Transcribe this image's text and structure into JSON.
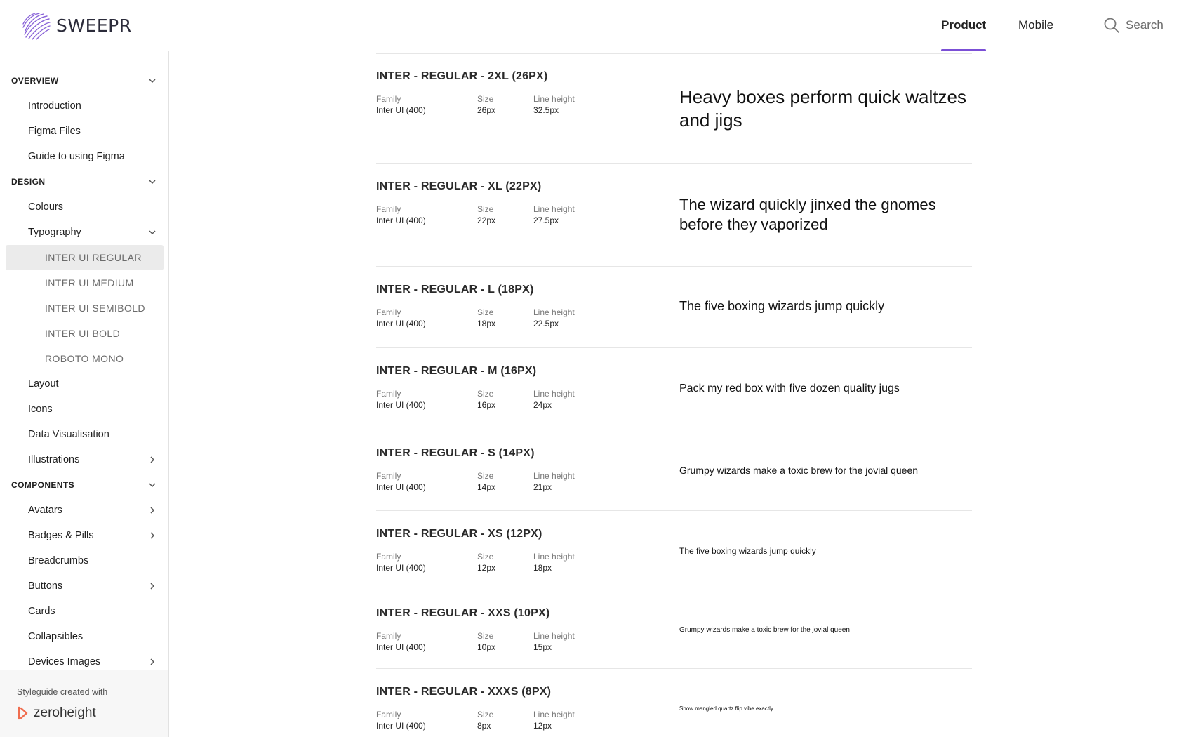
{
  "header": {
    "brand": "SWEEPR",
    "nav": [
      {
        "label": "Product",
        "active": true
      },
      {
        "label": "Mobile",
        "active": false
      }
    ],
    "search_label": "Search",
    "accent_color": "#7b4fd6"
  },
  "sidebar": {
    "overview": {
      "title": "OVERVIEW",
      "items": [
        "Introduction",
        "Figma Files",
        "Guide to using Figma"
      ]
    },
    "design": {
      "title": "DESIGN",
      "items": [
        "Colours",
        "Typography"
      ],
      "typography_sub": [
        "INTER UI REGULAR",
        "INTER UI MEDIUM",
        "INTER UI SEMIBOLD",
        "INTER UI BOLD",
        "ROBOTO MONO"
      ],
      "items_after": [
        "Layout",
        "Icons",
        "Data Visualisation",
        "Illustrations"
      ]
    },
    "components": {
      "title": "COMPONENTS",
      "items": [
        "Avatars",
        "Badges & Pills",
        "Breadcrumbs",
        "Buttons",
        "Cards",
        "Collapsibles",
        "Devices Images"
      ]
    },
    "footer": {
      "credit": "Styleguide created with",
      "brand": "zeroheight"
    }
  },
  "labels": {
    "family": "Family",
    "size": "Size",
    "line_height": "Line height"
  },
  "styles": [
    {
      "title": "INTER - REGULAR - 2XL (26PX)",
      "family": "Inter UI (400)",
      "size": "26px",
      "line_height": "32.5px",
      "sample": "Heavy boxes perform quick waltzes and jigs"
    },
    {
      "title": "INTER - REGULAR - XL (22PX)",
      "family": "Inter UI (400)",
      "size": "22px",
      "line_height": "27.5px",
      "sample": "The wizard quickly jinxed the gnomes before they vaporized"
    },
    {
      "title": "INTER - REGULAR - L (18PX)",
      "family": "Inter UI (400)",
      "size": "18px",
      "line_height": "22.5px",
      "sample": "The five boxing wizards jump quickly"
    },
    {
      "title": "INTER - REGULAR - M (16PX)",
      "family": "Inter UI (400)",
      "size": "16px",
      "line_height": "24px",
      "sample": "Pack my red box with five dozen quality jugs"
    },
    {
      "title": "INTER - REGULAR - S (14PX)",
      "family": "Inter UI (400)",
      "size": "14px",
      "line_height": "21px",
      "sample": "Grumpy wizards make a toxic brew for the jovial queen"
    },
    {
      "title": "INTER - REGULAR - XS (12PX)",
      "family": "Inter UI (400)",
      "size": "12px",
      "line_height": "18px",
      "sample": "The five boxing wizards jump quickly"
    },
    {
      "title": "INTER - REGULAR - XXS (10PX)",
      "family": "Inter UI (400)",
      "size": "10px",
      "line_height": "15px",
      "sample": "Grumpy wizards make a toxic brew for the jovial queen"
    },
    {
      "title": "INTER - REGULAR - XXXS (8PX)",
      "family": "Inter UI (400)",
      "size": "8px",
      "line_height": "12px",
      "sample": "Show mangled quartz flip vibe exactly"
    }
  ]
}
